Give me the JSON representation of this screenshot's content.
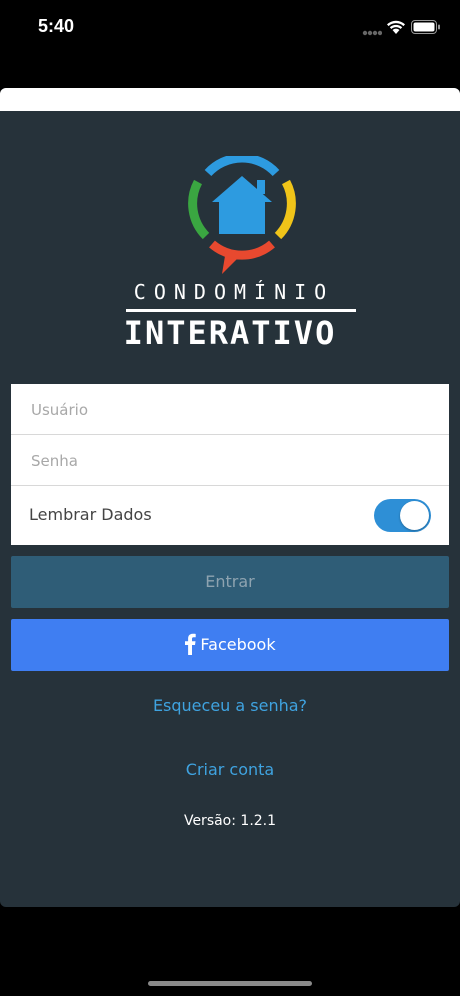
{
  "status": {
    "time": "5:40"
  },
  "brand": {
    "line1": "CONDOMÍNIO",
    "line2": "INTERATIVO"
  },
  "form": {
    "username_placeholder": "Usuário",
    "password_placeholder": "Senha",
    "remember_label": "Lembrar Dados",
    "remember_on": true
  },
  "buttons": {
    "enter": "Entrar",
    "facebook": "Facebook"
  },
  "links": {
    "forgot": "Esqueceu a senha?",
    "create": "Criar conta"
  },
  "footer": {
    "version_label": "Versão:",
    "version_number": "1.2.1"
  },
  "colors": {
    "background": "#26323a",
    "accent": "#2e8fd6",
    "facebook": "#3f7ef2",
    "link": "#3fa3e0",
    "logo_blue": "#2d9be0",
    "logo_green": "#3aa641",
    "logo_yellow": "#f0c419",
    "logo_red": "#e8492f"
  }
}
